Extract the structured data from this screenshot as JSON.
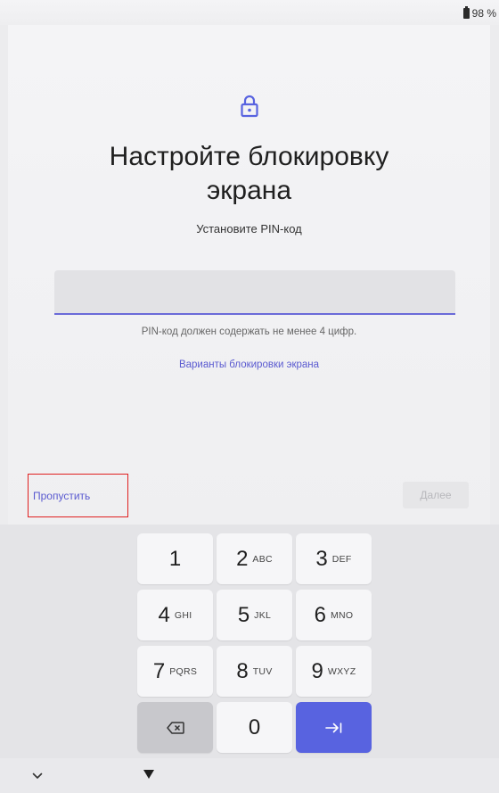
{
  "status_bar": {
    "battery_percent": "98 %"
  },
  "header": {
    "title_line1": "Настройте блокировку",
    "title_line2": "экрана",
    "subtitle": "Установите PIN-код"
  },
  "pin_field": {
    "value": ""
  },
  "hint": "PIN-код должен содержать не менее 4 цифр.",
  "lock_options_link": "Варианты блокировки экрана",
  "actions": {
    "skip_label": "Пропустить",
    "next_label": "Далее"
  },
  "keypad": {
    "keys": [
      {
        "num": "1",
        "letters": ""
      },
      {
        "num": "2",
        "letters": "ABC"
      },
      {
        "num": "3",
        "letters": "DEF"
      },
      {
        "num": "4",
        "letters": "GHI"
      },
      {
        "num": "5",
        "letters": "JKL"
      },
      {
        "num": "6",
        "letters": "MNO"
      },
      {
        "num": "7",
        "letters": "PQRS"
      },
      {
        "num": "8",
        "letters": "TUV"
      },
      {
        "num": "9",
        "letters": "WXYZ"
      },
      {
        "num": "0",
        "letters": ""
      }
    ],
    "backspace_icon": "backspace-icon",
    "enter_icon": "tab-enter-icon"
  },
  "colors": {
    "accent": "#5863e0",
    "link": "#5a5ad0",
    "highlight_box": "#e02020"
  }
}
